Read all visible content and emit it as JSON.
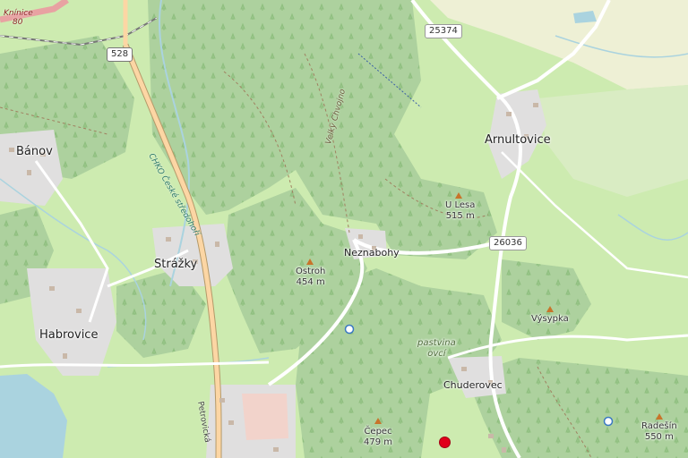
{
  "map": {
    "places": {
      "banov": "Bánov",
      "strazky": "Strážky",
      "habrovice": "Habrovice",
      "arnultovice": "Arnultovice",
      "neznabohy": "Neznabohy",
      "chuderovec": "Chuderovec"
    },
    "peaks": {
      "ostroh": {
        "name": "Ostroh",
        "elevation": "454 m"
      },
      "u_lesa": {
        "name": "U Lesa",
        "elevation": "515 m"
      },
      "cepec": {
        "name": "Čepec",
        "elevation": "479 m"
      },
      "radesin": {
        "name": "Radešín",
        "elevation": "550 m"
      },
      "vysypka": {
        "name": "Výsypka",
        "elevation": ""
      }
    },
    "areas": {
      "pastvina_line1": "pastvina",
      "pastvina_line2": "ovcí"
    },
    "roads": {
      "r528": "528",
      "r25374": "25374",
      "r26036": "26036",
      "knînice": "Knínice",
      "knînice_num": "80",
      "petrovicka": "Petrovická"
    },
    "streams": {
      "chko": "CHKO České středohoří",
      "velky_chvojno": "Velký Chvojno"
    },
    "colors": {
      "forest": "#add19e",
      "meadow": "#cdebb0",
      "residential": "#e0dfdf",
      "water": "#aad3df",
      "road_primary": "#fcd6a4",
      "marker": "#e0001b"
    }
  }
}
